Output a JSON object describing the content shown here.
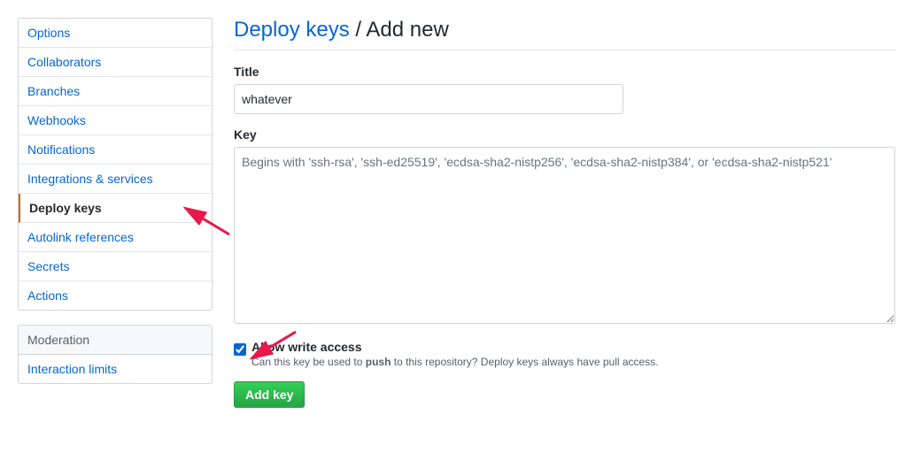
{
  "sidebar": {
    "items": [
      {
        "label": "Options"
      },
      {
        "label": "Collaborators"
      },
      {
        "label": "Branches"
      },
      {
        "label": "Webhooks"
      },
      {
        "label": "Notifications"
      },
      {
        "label": "Integrations & services"
      },
      {
        "label": "Deploy keys"
      },
      {
        "label": "Autolink references"
      },
      {
        "label": "Secrets"
      },
      {
        "label": "Actions"
      }
    ],
    "moderation_header": "Moderation",
    "moderation_items": [
      {
        "label": "Interaction limits"
      }
    ]
  },
  "subhead": {
    "link": "Deploy keys",
    "slash": " / ",
    "current": "Add new"
  },
  "form": {
    "title_label": "Title",
    "title_value": "whatever",
    "key_label": "Key",
    "key_placeholder": "Begins with 'ssh-rsa', 'ssh-ed25519', 'ecdsa-sha2-nistp256', 'ecdsa-sha2-nistp384', or 'ecdsa-sha2-nistp521'",
    "checkbox_label": "Allow write access",
    "checkbox_note_prefix": "Can this key be used to ",
    "checkbox_note_strong": "push",
    "checkbox_note_suffix": " to this repository? Deploy keys always have pull access.",
    "submit_label": "Add key"
  }
}
